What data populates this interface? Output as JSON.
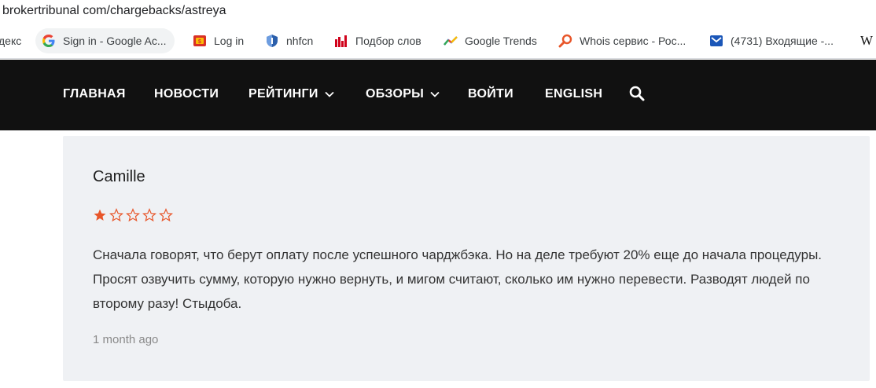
{
  "browser": {
    "url": "brokertribunal com/chargebacks/astreya"
  },
  "bookmarks": [
    {
      "label": "декс",
      "icon": "yandex-partial"
    },
    {
      "label": "Sign in - Google Ac...",
      "icon": "google-icon"
    },
    {
      "label": "Log in",
      "icon": "login-site-icon"
    },
    {
      "label": "nhfcn",
      "icon": "shield-icon"
    },
    {
      "label": "Подбор слов",
      "icon": "bar-chart-icon"
    },
    {
      "label": "Google Trends",
      "icon": "trends-icon"
    },
    {
      "label": "Whois сервис - Рос...",
      "icon": "magnifier-icon"
    },
    {
      "label": "(4731) Входящие -...",
      "icon": "mail-icon"
    },
    {
      "label": "W",
      "icon": "wikipedia-icon"
    }
  ],
  "nav": {
    "items": [
      {
        "label": "ГЛАВНАЯ",
        "dropdown": false
      },
      {
        "label": "НОВОСТИ",
        "dropdown": false
      },
      {
        "label": "РЕЙТИНГИ",
        "dropdown": true
      },
      {
        "label": "ОБЗОРЫ",
        "dropdown": true
      },
      {
        "label": "ВОЙТИ",
        "dropdown": false
      },
      {
        "label": "ENGLISH",
        "dropdown": false
      }
    ],
    "search_icon": "search-icon"
  },
  "review": {
    "author": "Camille",
    "rating": 1,
    "rating_max": 5,
    "text": "Сначала говорят, что берут оплату после успешного чарджбэка. Но на деле требуют 20% еще до начала процедуры. Просят озвучить сумму, которую нужно вернуть, и мигом считают, сколько им нужно перевести. Разводят людей по второму разу! Стыдоба.",
    "date": "1 month ago"
  },
  "colors": {
    "nav_bg": "#111111",
    "card_bg": "#eff1f4",
    "star": "#e8562a"
  }
}
